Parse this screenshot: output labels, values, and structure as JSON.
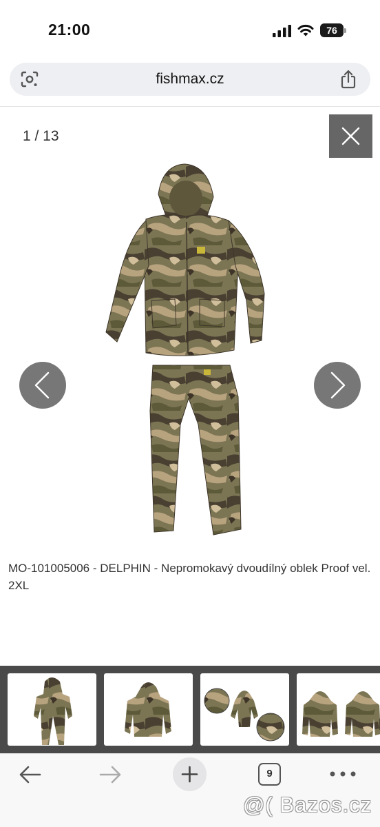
{
  "status_bar": {
    "time": "21:00",
    "battery": "76",
    "icons": [
      "cellular-signal-icon",
      "wifi-icon",
      "battery-icon"
    ]
  },
  "url_bar": {
    "url": "fishmax.cz",
    "icons": [
      "lens-icon",
      "share-icon"
    ]
  },
  "gallery": {
    "counter": "1 / 13",
    "caption": "MO-101005006 - DELPHIN - Nepromokavý dvoudílný oblek Proof vel. 2XL",
    "icons": [
      "close-icon",
      "chevron-left-icon",
      "chevron-right-icon"
    ],
    "main_image": "camouflage-rain-suit-image",
    "thumbnails": [
      "full-suit-thumbnail",
      "jacket-thumbnail",
      "detail-thumbnail",
      "front-back-thumbnail"
    ]
  },
  "toolbar": {
    "tab_count": "9",
    "icons": [
      "back-arrow-icon",
      "forward-arrow-icon",
      "plus-icon",
      "tabs-icon",
      "more-icon"
    ]
  },
  "watermark": "@( Bazos.cz",
  "colors": {
    "close_bg": "#666666",
    "nav_bg": "#777777",
    "thumb_strip_bg": "#4a4a4a",
    "url_bar_bg": "#eeeff2",
    "camo_dark": "#4a4032",
    "camo_olive": "#6b6a45",
    "camo_tan": "#b8a37f"
  }
}
